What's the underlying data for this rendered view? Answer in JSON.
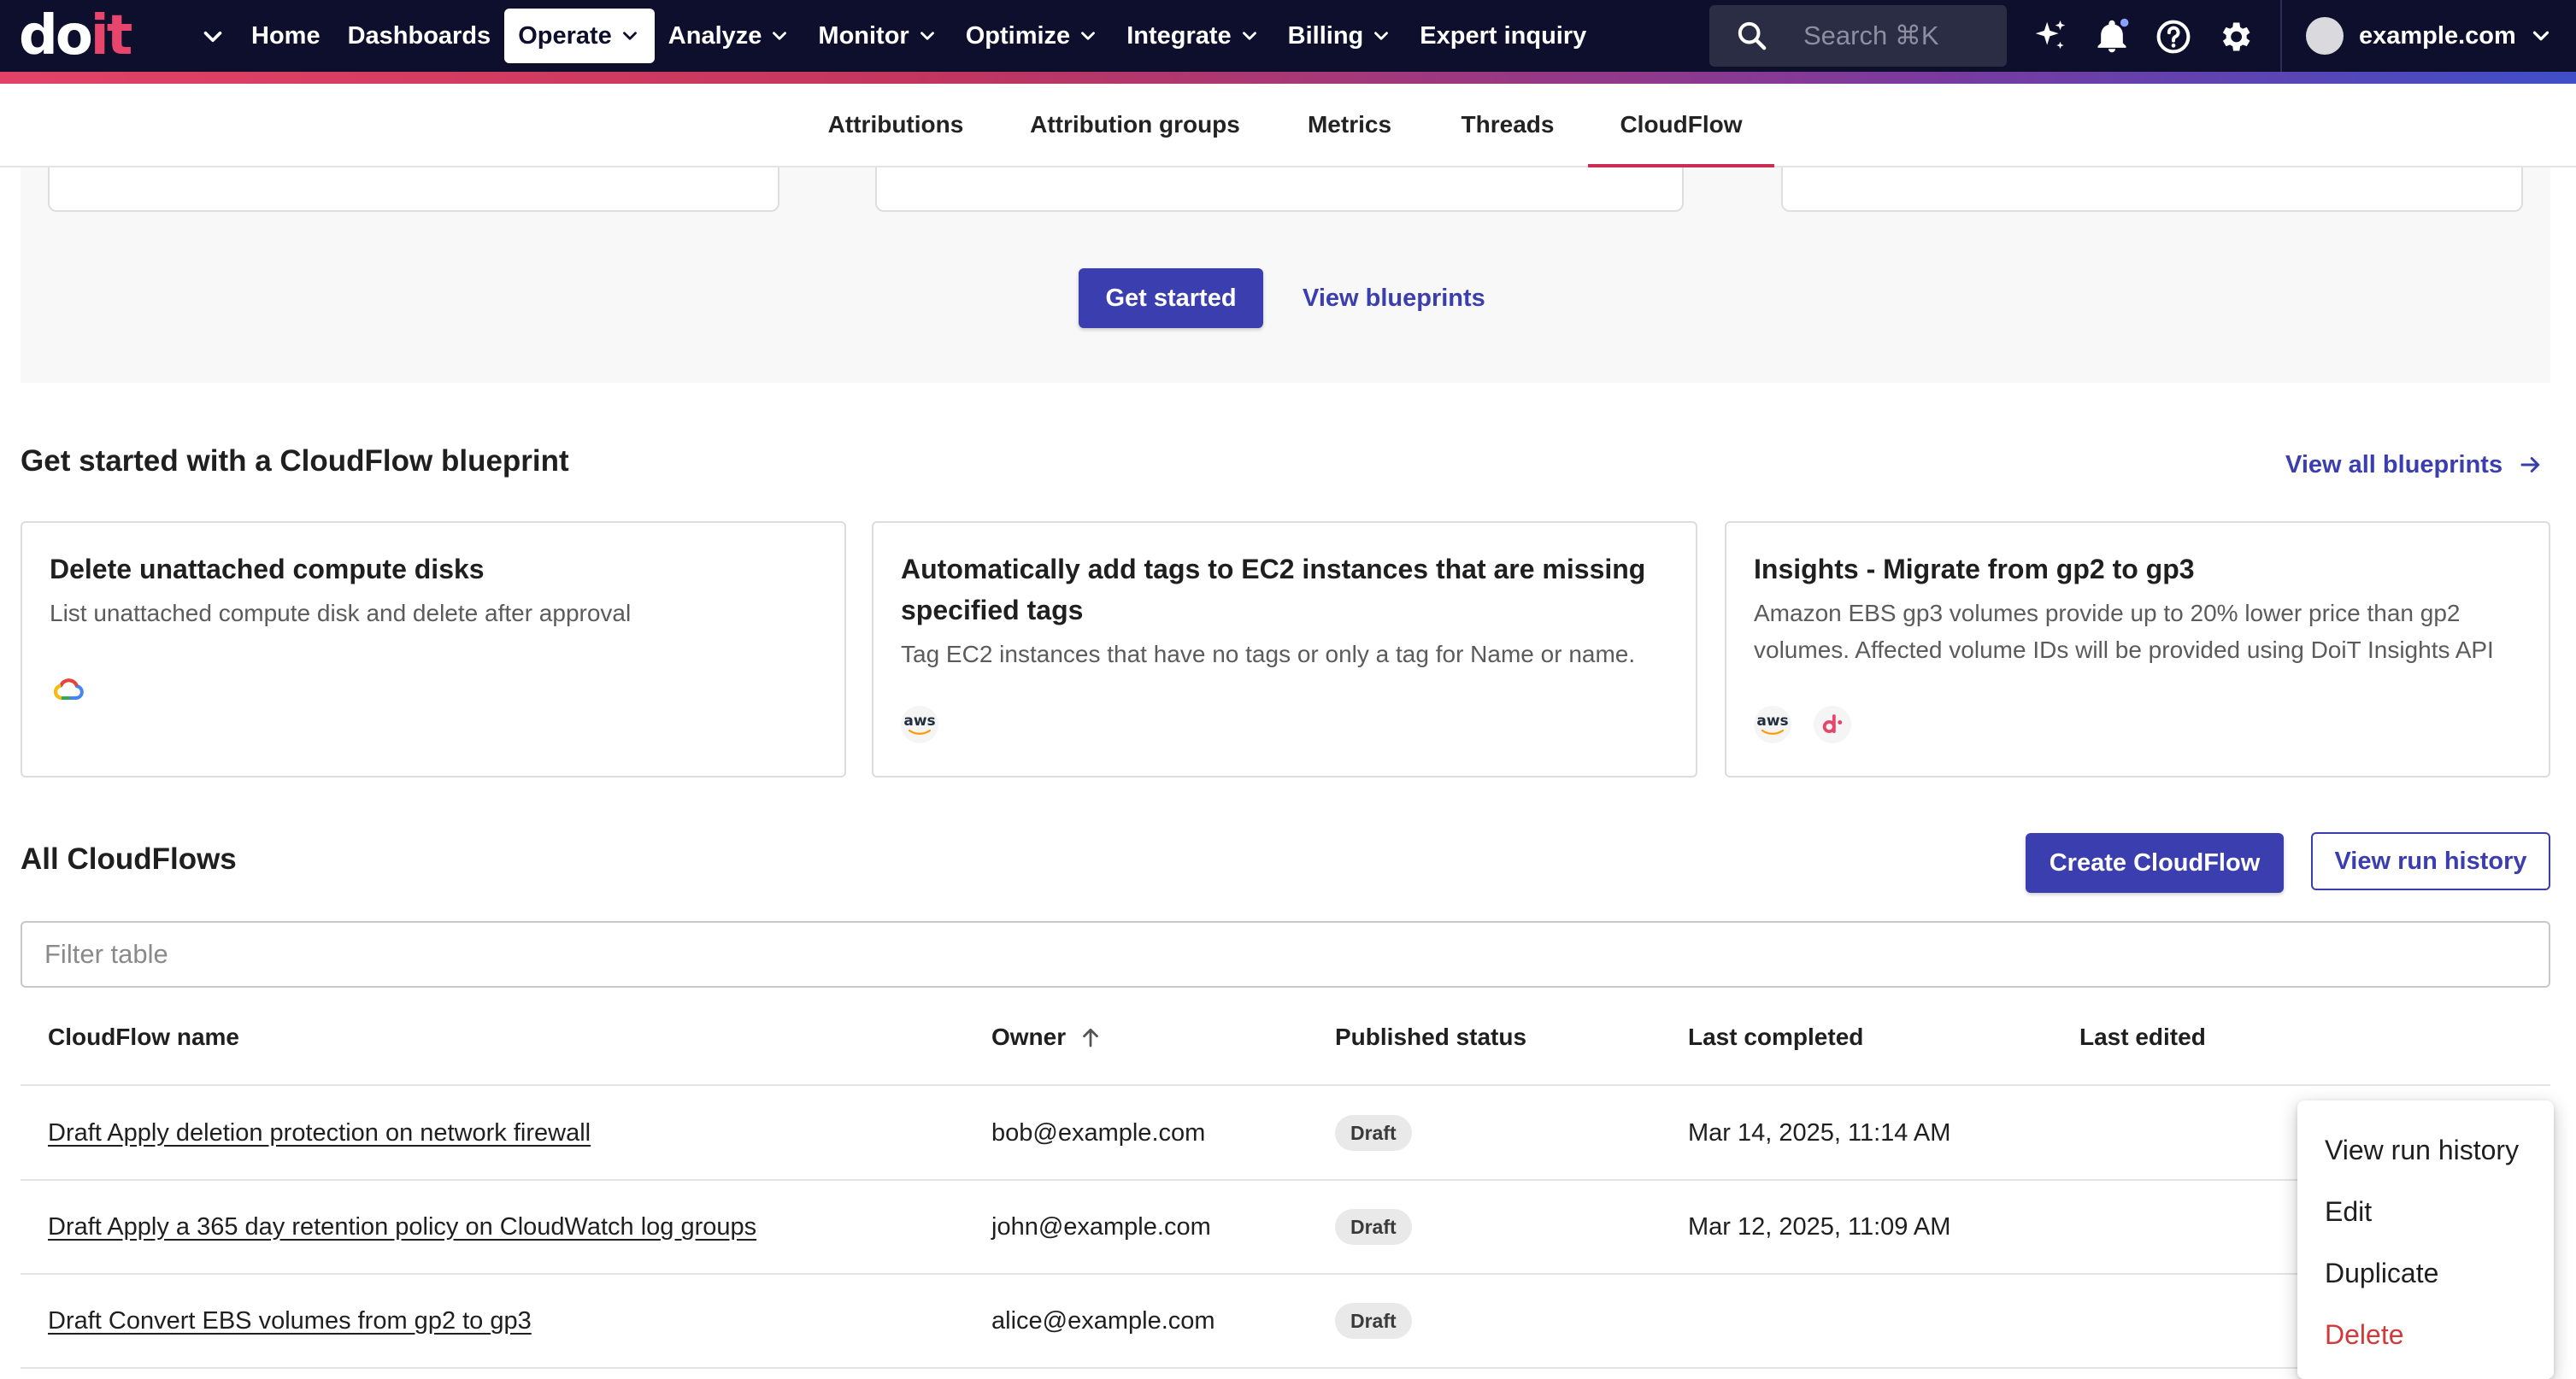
{
  "brand": {
    "logo_white": "do",
    "logo_pink": "it",
    "accent": "#e8456c",
    "nav_bg": "#0d0f2c",
    "primary": "#3b3eae"
  },
  "nav": {
    "items": [
      {
        "label": "Home"
      },
      {
        "label": "Dashboards"
      },
      {
        "label": "Operate",
        "active": true
      },
      {
        "label": "Analyze"
      },
      {
        "label": "Monitor"
      },
      {
        "label": "Optimize"
      },
      {
        "label": "Integrate"
      },
      {
        "label": "Billing"
      },
      {
        "label": "Expert inquiry"
      }
    ],
    "search_placeholder": "Search ⌘K",
    "account": "example.com"
  },
  "subtabs": [
    "Attributions",
    "Attribution groups",
    "Metrics",
    "Threads",
    "CloudFlow"
  ],
  "hero": {
    "get_started": "Get started",
    "view_blueprints": "View blueprints"
  },
  "blueprints": {
    "title": "Get started with a CloudFlow blueprint",
    "view_all": "View all blueprints",
    "cards": [
      {
        "title": "Delete unattached compute disks",
        "desc": "List unattached compute disk and delete after approval",
        "icons": [
          "google-cloud-icon"
        ]
      },
      {
        "title": "Automatically add tags to EC2 instances that are missing specified tags",
        "desc": "Tag EC2 instances that have no tags or only a tag for Name or name.",
        "icons": [
          "aws-icon"
        ],
        "aws_text": "aws"
      },
      {
        "title": "Insights - Migrate from gp2 to gp3",
        "desc": "Amazon EBS gp3 volumes provide up to 20% lower price than gp2 volumes. Affected volume IDs will be provided using DoiT Insights API",
        "icons": [
          "aws-icon",
          "doit-icon"
        ],
        "aws_text": "aws"
      }
    ]
  },
  "cloudflows": {
    "title": "All CloudFlows",
    "create": "Create CloudFlow",
    "history": "View run history",
    "filter_placeholder": "Filter table",
    "columns": [
      "CloudFlow name",
      "Owner",
      "Published status",
      "Last completed",
      "Last edited"
    ],
    "sort_column": "Owner",
    "rows": [
      {
        "name": "Draft Apply deletion protection on network firewall",
        "owner": "bob@example.com",
        "status": "Draft",
        "last_completed": "Mar 14, 2025, 11:14 AM",
        "last_edited": ""
      },
      {
        "name": "Draft Apply a 365 day retention policy on CloudWatch log groups",
        "owner": "john@example.com",
        "status": "Draft",
        "last_completed": "Mar 12, 2025, 11:09 AM",
        "last_edited": ""
      },
      {
        "name": "Draft Convert EBS volumes from gp2 to gp3",
        "owner": "alice@example.com",
        "status": "Draft",
        "last_completed": "",
        "last_edited": ""
      }
    ]
  },
  "context_menu": {
    "items": [
      {
        "label": "View run history"
      },
      {
        "label": "Edit"
      },
      {
        "label": "Duplicate"
      },
      {
        "label": "Delete",
        "danger": true
      }
    ]
  }
}
